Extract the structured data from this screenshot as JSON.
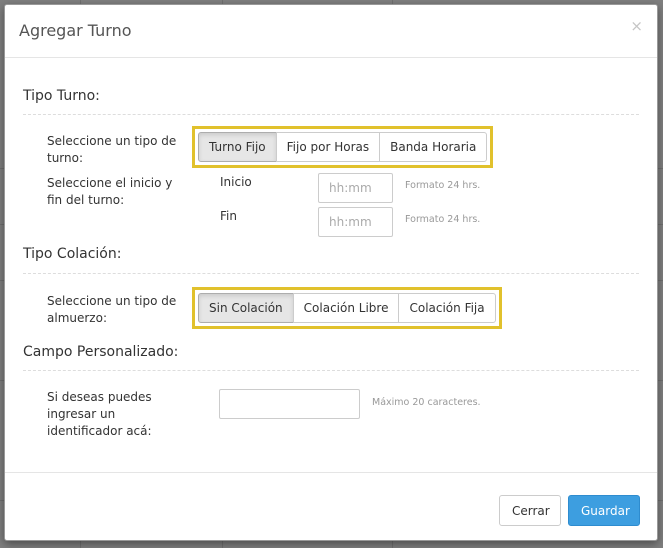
{
  "modal": {
    "title": "Agregar Turno",
    "close_glyph": "×"
  },
  "tipo_turno": {
    "section_title": "Tipo Turno:",
    "type_label": "Seleccione un tipo de turno:",
    "options": [
      "Turno Fijo",
      "Fijo por Horas",
      "Banda Horaria"
    ],
    "selected": "Turno Fijo",
    "range_label": "Seleccione el inicio y fin del turno:",
    "start_label": "Inicio",
    "end_label": "Fin",
    "time_placeholder": "hh:mm",
    "format_hint": "Formato 24 hrs."
  },
  "tipo_colacion": {
    "section_title": "Tipo Colación:",
    "type_label": "Seleccione un tipo de almuerzo:",
    "options": [
      "Sin Colación",
      "Colación Libre",
      "Colación Fija"
    ],
    "selected": "Sin Colación"
  },
  "campo_personalizado": {
    "section_title": "Campo Personalizado:",
    "label": "Si deseas puedes ingresar un identificador acá:",
    "value": "",
    "hint": "Máximo 20 caracteres."
  },
  "footer": {
    "close_label": "Cerrar",
    "save_label": "Guardar"
  },
  "colors": {
    "highlight": "#e1c12c",
    "primary": "#3d9ee0"
  }
}
